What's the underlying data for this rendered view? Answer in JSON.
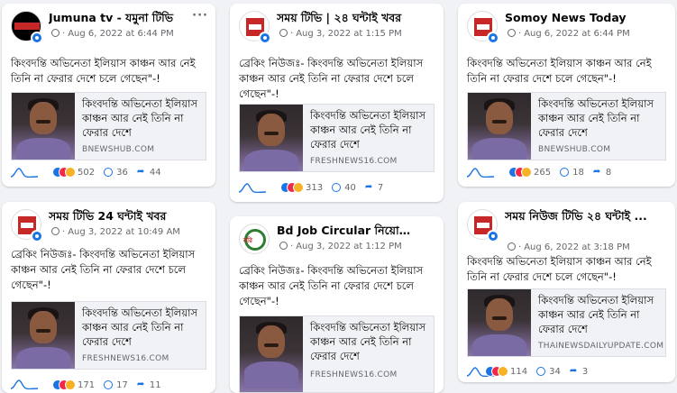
{
  "posts": [
    {
      "page": "Jumuna tv - যমুনা টিভি",
      "date": "Aug 6, 2022 at 6:44 PM",
      "text": "কিংবদন্তি অভিনেতা ইলিয়াস কাঞ্চন আর নেই তিনি না ফেরার দেশে চলে গেছেন\"-!",
      "link_title": "কিংবদন্তি অভিনেতা ইলিয়াস কাঞ্চন আর নেই তিনি না ফেরার দেশে",
      "domain": "BNEWSHUB.COM",
      "reactions": "502",
      "comments": "36",
      "shares": "44"
    },
    {
      "page": "সময় টিভি | ২৪ ঘন্টাই খবর",
      "date": "Aug 3, 2022 at 1:15 PM",
      "text": "ব্রেকিং নিউজঃ- কিংবদন্তি অভিনেতা ইলিয়াস কাঞ্চন আর নেই তিনি না ফেরার দেশে চলে গেছেন\"-!",
      "link_title": "কিংবদন্তি অভিনেতা ইলিয়াস কাঞ্চন আর নেই তিনি না ফেরার দেশে",
      "domain": "FRESHNEWS16.COM",
      "reactions": "313",
      "comments": "40",
      "shares": "7"
    },
    {
      "page": "Somoy News Today",
      "date": "Aug 6, 2022 at 6:44 PM",
      "text": "কিংবদন্তি অভিনেতা ইলিয়াস কাঞ্চন আর নেই তিনি না ফেরার দেশে চলে গেছেন\"-!",
      "link_title": "কিংবদন্তি অভিনেতা ইলিয়াস কাঞ্চন আর নেই তিনি না ফেরার দেশে",
      "domain": "BNEWSHUB.COM",
      "reactions": "265",
      "comments": "18",
      "shares": "8"
    },
    {
      "page": "সময় টিভি 24 ঘন্টাই খবর",
      "date": "Aug 3, 2022 at 10:49 AM",
      "text": "ব্রেকিং নিউজঃ- কিংবদন্তি অভিনেতা ইলিয়াস কাঞ্চন আর নেই তিনি না ফেরার দেশে চলে গেছেন\"-!",
      "link_title": "কিংবদন্তি অভিনেতা ইলিয়াস কাঞ্চন আর নেই তিনি না ফেরার দেশে",
      "domain": "FRESHNEWS16.COM",
      "reactions": "171",
      "comments": "17",
      "shares": "11"
    },
    {
      "page": "Bd Job Circular নিয়োগ ...",
      "date": "Aug 3, 2022 at 1:12 PM",
      "text": "ব্রেকিং নিউজঃ- কিংবদন্তি অভিনেতা ইলিয়াস কাঞ্চন আর নেই তিনি না ফেরার দেশে চলে গেছেন\"-!",
      "link_title": "কিংবদন্তি অভিনেতা ইলিয়াস কাঞ্চন আর নেই তিনি না ফেরার দেশে",
      "domain": "FRESHNEWS16.COM",
      "reactions": "",
      "comments": "",
      "shares": ""
    },
    {
      "page": "সময় নিউজ টিভি ২৪ ঘন্টাই ...",
      "date": "Aug 6, 2022 at 3:18 PM",
      "text": "কিংবদন্তি অভিনেতা ইলিয়াস কাঞ্চন আর নেই তিনি না ফেরার দেশে চলে গেছেন\"-!",
      "link_title": "কিংবদন্তি অভিনেতা ইলিয়াস কাঞ্চন আর নেই তিনি না ফেরার দেশে",
      "domain": "THAINEWSDAILYUPDATE.COM",
      "reactions": "114",
      "comments": "34",
      "shares": "3"
    }
  ],
  "colors": {
    "accent": "#1b74e4",
    "love": "#f02849",
    "background": "#f0f2f5"
  },
  "icons": {
    "globe": "globe-icon",
    "verified": "verified-badge-icon",
    "more": "more-dots-icon",
    "comment": "comment-icon",
    "share": "share-icon"
  }
}
